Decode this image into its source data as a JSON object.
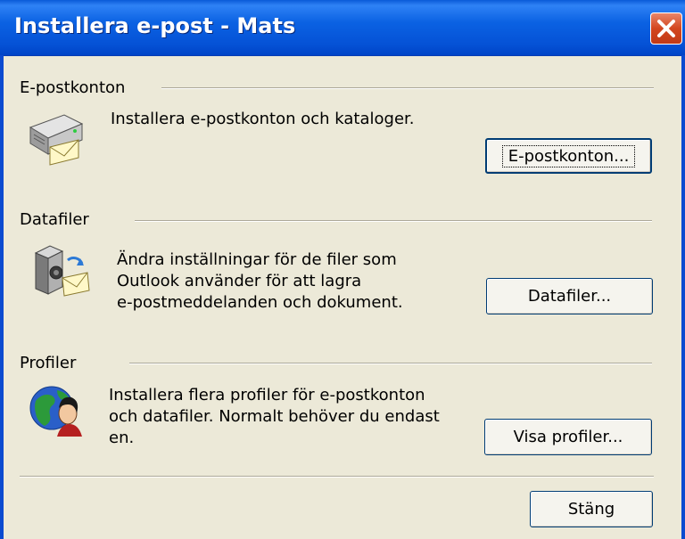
{
  "window": {
    "title": "Installera e-post - Mats"
  },
  "sections": {
    "email": {
      "label": "E-postkonton",
      "description": "Installera e-postkonton och kataloger.",
      "button": "E-postkonton..."
    },
    "datafiles": {
      "label": "Datafiler",
      "description_lines": [
        "Ändra inställningar för de filer som",
        "Outlook använder för att lagra",
        "e-postmeddelanden och dokument."
      ],
      "button": "Datafiler..."
    },
    "profiles": {
      "label": "Profiler",
      "description_lines": [
        "Installera flera profiler för e-postkonton",
        "och datafiler. Normalt behöver du endast",
        "en."
      ],
      "button": "Visa profiler..."
    }
  },
  "footer": {
    "close_label": "Stäng"
  },
  "icons": {
    "close": "close-icon",
    "email": "mail-server-icon",
    "datafiles": "data-file-icon",
    "profiles": "globe-profile-icon"
  }
}
